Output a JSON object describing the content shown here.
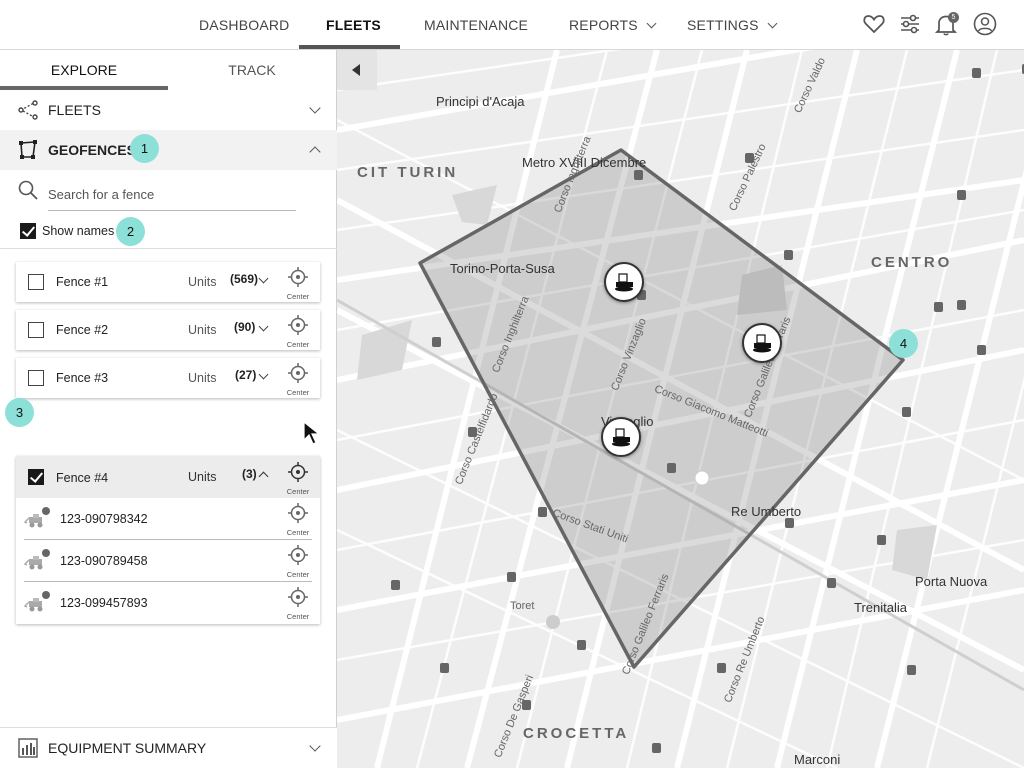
{
  "nav": {
    "items": [
      {
        "label": "DASHBOARD",
        "has_menu": false,
        "active": false
      },
      {
        "label": "FLEETS",
        "has_menu": false,
        "active": true
      },
      {
        "label": "MAINTENANCE",
        "has_menu": false,
        "active": false
      },
      {
        "label": "REPORTS",
        "has_menu": true,
        "active": false
      },
      {
        "label": "SETTINGS",
        "has_menu": true,
        "active": false
      }
    ],
    "icons": [
      "heart-icon",
      "sliders-icon",
      "bell-icon",
      "user-icon"
    ],
    "notification_count": "5"
  },
  "panel": {
    "tabs": [
      {
        "label": "EXPLORE",
        "active": true
      },
      {
        "label": "TRACK",
        "active": false
      }
    ],
    "fleets_label": "FLEETS",
    "geofences_label": "GEOFENCES",
    "search_placeholder": "Search for a fence",
    "show_names_label": "Show names",
    "show_names_checked": true,
    "callouts": [
      "1",
      "2",
      "3",
      "4"
    ],
    "fences": [
      {
        "name": "Fence #1",
        "units_label": "Units",
        "count": "(569)",
        "center_label": "Center",
        "checked": false
      },
      {
        "name": "Fence #2",
        "units_label": "Units",
        "count": "(90)",
        "center_label": "Center",
        "checked": false
      },
      {
        "name": "Fence #3",
        "units_label": "Units",
        "count": "(27)",
        "center_label": "Center",
        "checked": false
      },
      {
        "name": "Fence #4",
        "units_label": "Units",
        "count": "(3)",
        "center_label": "Center",
        "checked": true,
        "units": [
          {
            "id": "123-090798342",
            "center_label": "Center"
          },
          {
            "id": "123-090789458",
            "center_label": "Center"
          },
          {
            "id": "123-099457893",
            "center_label": "Center"
          }
        ]
      }
    ],
    "equipment_summary_label": "EQUIPMENT SUMMARY"
  },
  "map": {
    "labels": {
      "principi": "Principi d'Acaja",
      "cit_turin": "CIT TURIN",
      "metro": "Metro XVIII Dicembre",
      "torino_porta_susa": "Torino-Porta-Susa",
      "centro": "CENTRO",
      "corso_inghilterra_1": "Corso Inghilterra",
      "corso_inghilterra_2": "Corso Inghilterra",
      "corso_palestro": "Corso Palestro",
      "corso_valdocco": "Corso Valdo",
      "corso_vinzaglio": "Corso Vinzaglio",
      "corso_giacomo_matteotti": "Corso Giacomo Matteotti",
      "corso_galileo_ferraris_1": "Corso Galileo Ferraris",
      "corso_galileo_ferraris_2": "Corso Galileo Ferraris",
      "corso_castelfidardo": "Corso Castelfidardo",
      "vinzaglio": "Vinzaglio",
      "corso_stati_uniti": "Corso Stati Uniti",
      "re_umberto": "Re Umberto",
      "corso_re_umberto": "Corso Re Umberto",
      "porta_nuova": "Porta Nuova",
      "trenitalia": "Trenitalia",
      "toret": "Toret",
      "crocetta": "CROCETTA",
      "corso_de_gasperi": "Corso De Gasperi",
      "marconi": "Marconi"
    }
  }
}
